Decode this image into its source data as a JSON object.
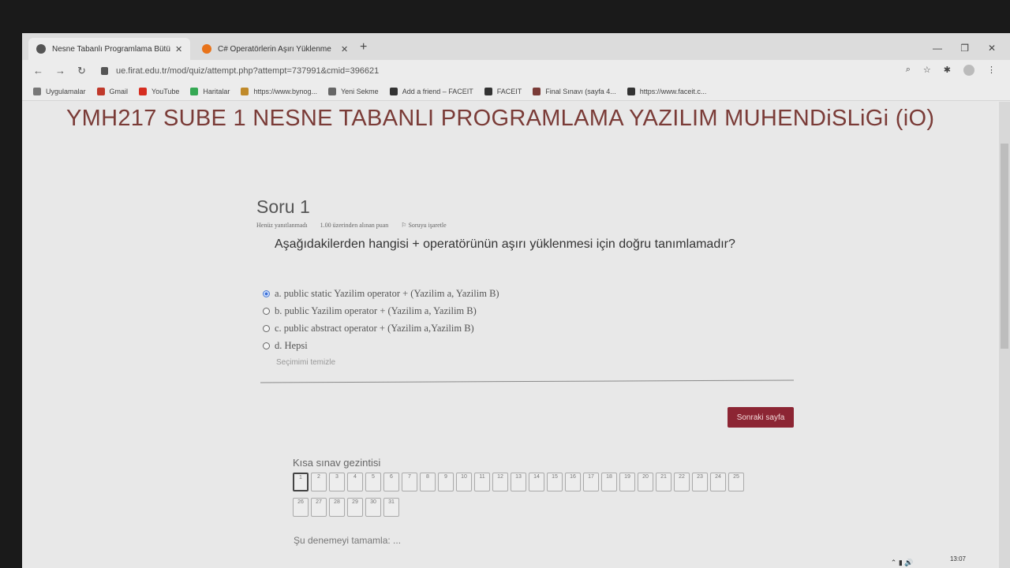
{
  "browser": {
    "tabs": [
      {
        "title": "Nesne Tabanlı Programlama Bütü",
        "icon_color": "#555555",
        "active": true
      },
      {
        "title": "C# Operatörlerin Aşırı Yüklenme",
        "icon_color": "#e8731a",
        "active": false
      }
    ],
    "new_tab": "+",
    "url": "ue.firat.edu.tr/mod/quiz/attempt.php?attempt=737991&cmid=396621",
    "bookmarks": [
      {
        "label": "Uygulamalar",
        "icon_color": "#777777"
      },
      {
        "label": "Gmail",
        "icon_color": "#c0392b"
      },
      {
        "label": "YouTube",
        "icon_color": "#d62d20"
      },
      {
        "label": "Haritalar",
        "icon_color": "#34a853"
      },
      {
        "label": "https://www.bynog...",
        "icon_color": "#c08a2a"
      },
      {
        "label": "Yeni Sekme",
        "icon_color": "#666666"
      },
      {
        "label": "Add a friend – FACEIT",
        "icon_color": "#333333"
      },
      {
        "label": "FACEIT",
        "icon_color": "#333333"
      },
      {
        "label": "Final Sınavı (sayfa 4...",
        "icon_color": "#7a3b37"
      },
      {
        "label": "https://www.faceit.c...",
        "icon_color": "#333333"
      }
    ]
  },
  "page": {
    "course_title": "YMH217 SUBE 1 NESNE TABANLI PROGRAMLAMA YAZILIM MUHENDiSLiGi (iO)",
    "question": {
      "number": "Soru 1",
      "status": "Henüz yanıtlanmadı",
      "points": "1.00 üzerinden alınan puan",
      "flag": "Soruyu işaretle",
      "text": "Aşağıdakilerden hangisi + operatörünün aşırı yüklenmesi için doğru tanımlamadır?",
      "answers": [
        {
          "label": "a. public static Yazilim operator + (Yazilim a, Yazilim B)",
          "checked": true
        },
        {
          "label": "b. public Yazilim operator + (Yazilim a, Yazilim B)",
          "checked": false
        },
        {
          "label": "c. public abstract operator + (Yazilim a,Yazilim B)",
          "checked": false
        },
        {
          "label": "d. Hepsi",
          "checked": false
        }
      ],
      "clear_choice": "Seçimimi temizle"
    },
    "next_button": "Sonraki sayfa",
    "quiz_nav": {
      "title": "Kısa sınav gezintisi",
      "questions": [
        "1",
        "2",
        "3",
        "4",
        "5",
        "6",
        "7",
        "8",
        "9",
        "10",
        "11",
        "12",
        "13",
        "14",
        "15",
        "16",
        "17",
        "18",
        "19",
        "20",
        "21",
        "22",
        "23",
        "24",
        "25",
        "26",
        "27",
        "28",
        "29",
        "30",
        "31"
      ],
      "current": "1"
    },
    "finish_attempt": "Şu denemeyi tamamla: ..."
  },
  "taskbar": {
    "time": "13:07"
  }
}
